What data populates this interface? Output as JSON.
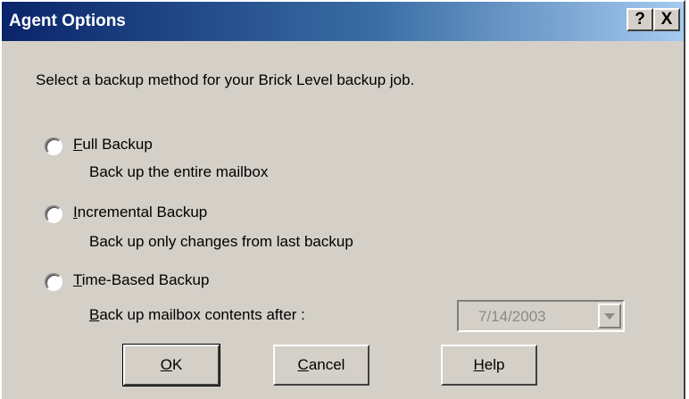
{
  "window": {
    "title": "Agent Options"
  },
  "title_buttons": {
    "help": "?",
    "close": "X"
  },
  "instruction": "Select a backup method for your Brick Level backup job.",
  "options": [
    {
      "label_first": "F",
      "label_rest": "ull Backup",
      "description": "Back up the entire mailbox",
      "selected": false
    },
    {
      "label_first": "I",
      "label_rest": "ncremental Backup",
      "description": "Back up only changes from last backup",
      "selected": false
    },
    {
      "label_first": "T",
      "label_rest": "ime-Based Backup",
      "description": "",
      "selected": false
    }
  ],
  "after_field": {
    "label_first": "B",
    "label_rest": "ack up mailbox contents after :",
    "value": "7/14/2003",
    "enabled": false
  },
  "buttons": {
    "ok_first": "O",
    "ok_rest": "K",
    "cancel_first": "C",
    "cancel_rest": "ancel",
    "help_first": "H",
    "help_rest": "elp"
  }
}
